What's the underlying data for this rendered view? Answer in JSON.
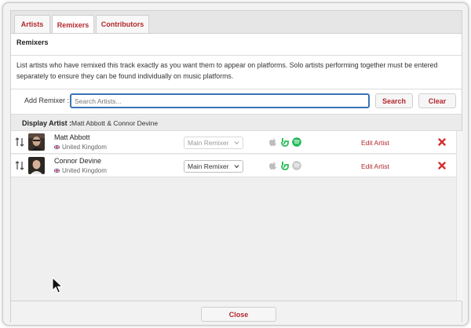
{
  "tabs": [
    {
      "label": "Artists",
      "active": false
    },
    {
      "label": "Remixers",
      "active": true
    },
    {
      "label": "Contributors",
      "active": false
    }
  ],
  "panel": {
    "title": "Remixers",
    "description": "List artists who have remixed this track exactly as you want them to appear on platforms. Solo artists performing together must be entered separately to ensure they can be found individually on music platforms."
  },
  "search": {
    "label": "Add Remixer :",
    "placeholder": "Search Artists...",
    "value": "",
    "search_button": "Search",
    "clear_button": "Clear"
  },
  "display_artist": {
    "label": "Display Artist :",
    "value": "Matt Abbott & Connor Devine"
  },
  "artists": [
    {
      "name": "Matt Abbott",
      "country": "United Kingdom",
      "role": "Main Remixer",
      "role_enabled": false,
      "platforms": {
        "apple": "inactive",
        "audiomack": "active",
        "spotify": "active"
      },
      "edit_label": "Edit Artist"
    },
    {
      "name": "Connor Devine",
      "country": "United Kingdom",
      "role": "Main Remixer",
      "role_enabled": true,
      "platforms": {
        "apple": "inactive",
        "audiomack": "active",
        "spotify": "inactive"
      },
      "edit_label": "Edit Artist"
    }
  ],
  "footer": {
    "close_label": "Close"
  },
  "colors": {
    "accent": "#b3282d",
    "spotify": "#1db954",
    "audiomack": "#2bbf5a",
    "inactive_icon": "#bdbdbd",
    "input_focus": "#3b73b9"
  },
  "icons": {
    "reorder": "reorder-arrows-icon",
    "apple": "apple-music-icon",
    "audiomack": "audiomack-icon",
    "spotify": "spotify-icon",
    "remove": "remove-x-icon",
    "flag": "uk-flag-icon",
    "dropdown": "chevron-down-icon",
    "cursor": "mouse-cursor-icon"
  }
}
